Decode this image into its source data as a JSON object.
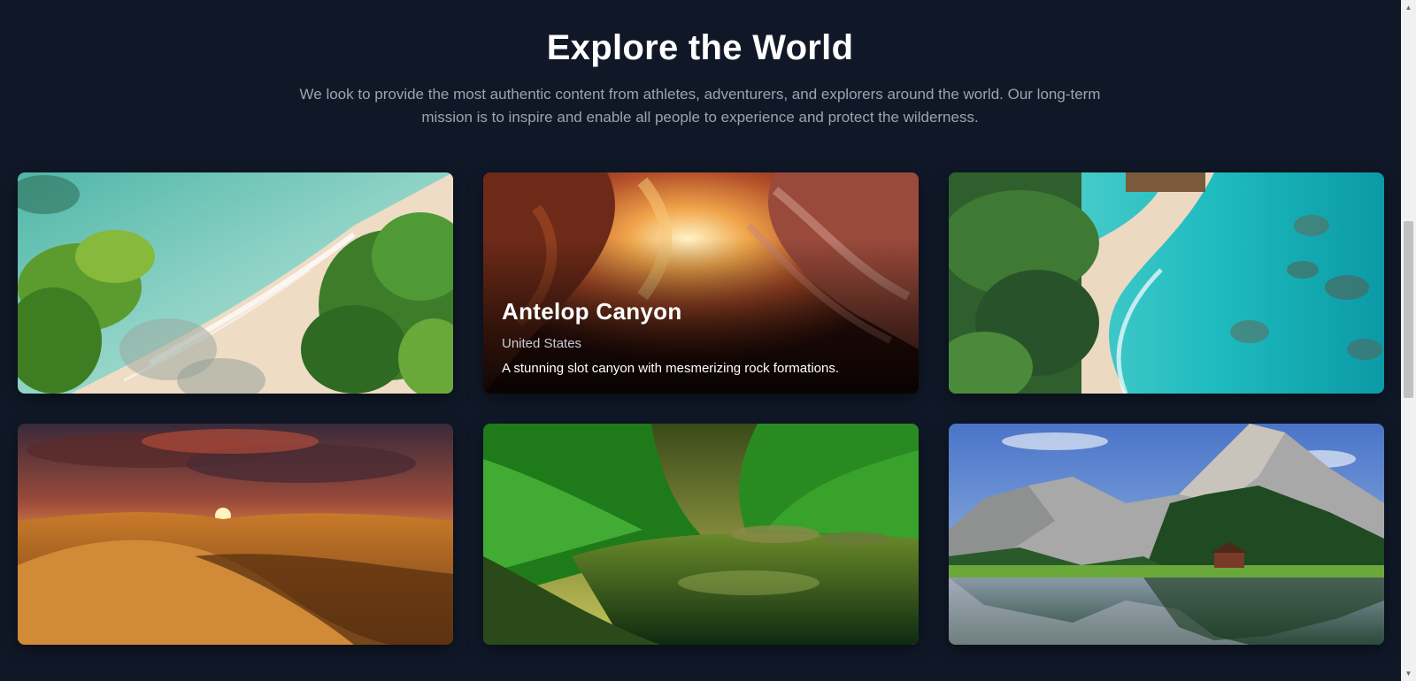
{
  "header": {
    "title": "Explore the World",
    "subtitle": "We look to provide the most authentic content from athletes, adventurers, and explorers around the world. Our long-term mission is to inspire and enable all people to experience and protect the wilderness."
  },
  "cards": [
    {
      "scene": "tropical-beach"
    },
    {
      "scene": "slot-canyon",
      "title": "Antelop Canyon",
      "location": "United States",
      "description": "A stunning slot canyon with mesmerizing rock formations."
    },
    {
      "scene": "turquoise-lagoon"
    },
    {
      "scene": "desert-sunset"
    },
    {
      "scene": "forest-river"
    },
    {
      "scene": "alpine-lake"
    }
  ],
  "colors": {
    "background": "#101828",
    "title": "#ffffff",
    "subtitle": "#9ca3af"
  },
  "scrollbar": {
    "up_icon": "arrow-up-icon",
    "down_icon": "arrow-down-icon"
  }
}
